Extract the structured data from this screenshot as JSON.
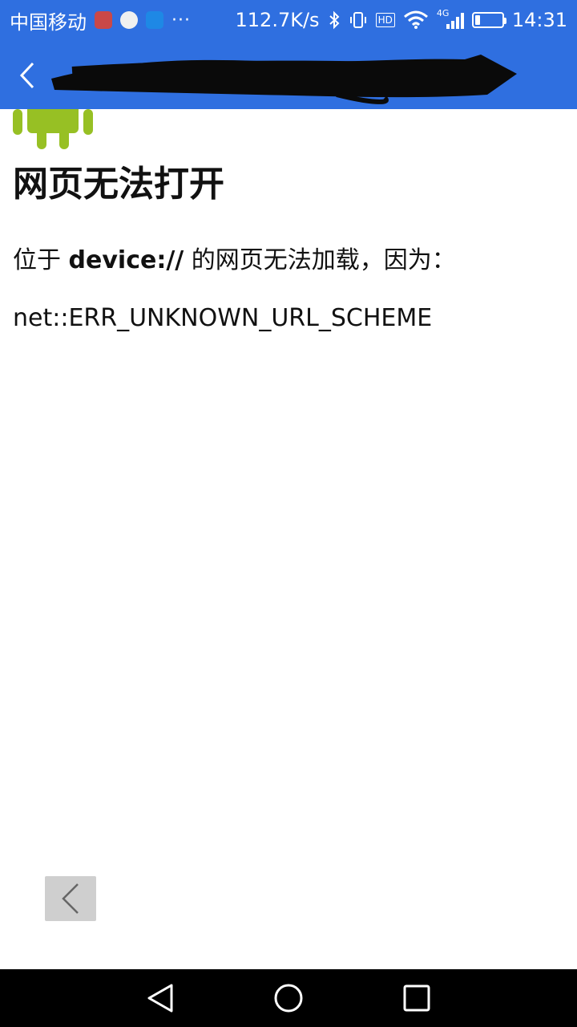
{
  "status_bar": {
    "carrier": "中国移动",
    "more": "···",
    "net_speed": "112.7K/s",
    "hd": "HD",
    "network_type": "4G",
    "time": "14:31",
    "battery_level": 0.16,
    "icons": [
      "app-notification-icon",
      "app-notification-icon",
      "message-icon",
      "bluetooth-icon",
      "vibrate-icon",
      "hd-icon",
      "wifi-icon",
      "signal-icon",
      "battery-icon"
    ]
  },
  "colors": {
    "accent": "#2f6fe0",
    "android_green": "#97c024",
    "nav_bar": "#000000"
  },
  "app_bar": {
    "title": ""
  },
  "content": {
    "title": "网页无法打开",
    "line_prefix": "位于 ",
    "line_url": "device://",
    "line_suffix": " 的网页无法加载，因为：",
    "error_code": "net::ERR_UNKNOWN_URL_SCHEME"
  }
}
